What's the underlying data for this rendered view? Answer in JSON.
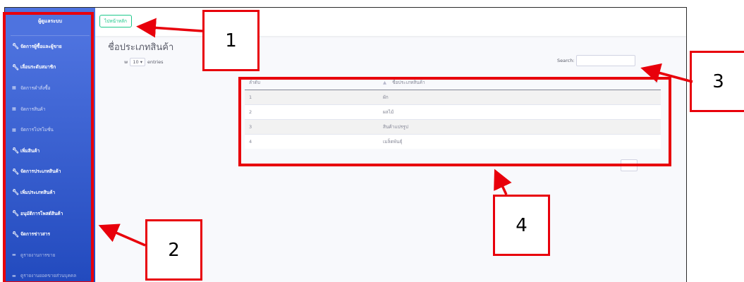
{
  "sidebar": {
    "brand": "ผู้ดูแลระบบ",
    "items": [
      {
        "label": "จัดการผู้ซื้อและผู้ขาย",
        "icon": "wrench-icon",
        "style": "bold"
      },
      {
        "label": "เลื่อนระดับสมาชิก",
        "icon": "wrench-icon",
        "style": "bold"
      },
      {
        "label": "จัดการคำสั่งซื้อ",
        "icon": "table-icon",
        "style": "dim"
      },
      {
        "label": "จัดการสินค้า",
        "icon": "table-icon",
        "style": "dim"
      },
      {
        "label": "จัดการโปรโมชั่น",
        "icon": "table-icon",
        "style": "dim"
      },
      {
        "label": "เพิ่มสินค้า",
        "icon": "wrench-icon",
        "style": "bold"
      },
      {
        "label": "จัดการประเภทสินค้า",
        "icon": "wrench-icon",
        "style": "bold"
      },
      {
        "label": "เพิ่มประเภทสินค้า",
        "icon": "wrench-icon",
        "style": "bold"
      },
      {
        "label": "อนุมัติการโพสต์สินค้า",
        "icon": "wrench-icon",
        "style": "bold"
      },
      {
        "label": "จัดการข่าวสาร",
        "icon": "wrench-icon",
        "style": "bold"
      },
      {
        "label": "ดูรายงานการขาย",
        "icon": "folder-icon",
        "style": "faint"
      },
      {
        "label": "ดูรายงานยอดขายส่วนบุคคล",
        "icon": "folder-icon",
        "style": "faint"
      }
    ]
  },
  "topbar": {
    "home_button": "ไปหน้าหลัก"
  },
  "main": {
    "title": "ชื่อประเภทสินค้า",
    "length_prefix": "w",
    "length_value": "10",
    "length_suffix": "entries",
    "search_label": "Search:",
    "table": {
      "headers": [
        "ลำดับ",
        "ชื่อประเภทสินค้า"
      ],
      "rows": [
        [
          "1",
          "ผัก"
        ],
        [
          "2",
          "ผลไม้"
        ],
        [
          "3",
          "สินค้าแปรรูป"
        ],
        [
          "4",
          "เมล็ดพันธุ์"
        ]
      ]
    }
  },
  "annotations": {
    "labels": [
      "1",
      "2",
      "3",
      "4"
    ],
    "color": "#e8000b"
  },
  "colors": {
    "sidebar_top": "#4e73df",
    "sidebar_bottom": "#224abe",
    "home_button": "#1cc88a"
  }
}
